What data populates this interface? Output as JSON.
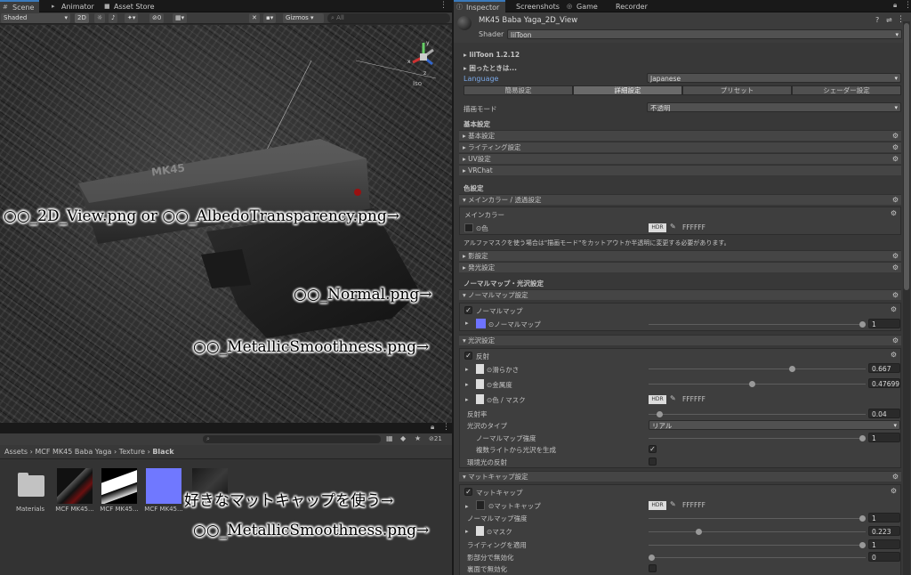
{
  "left_tabs": [
    "Scene",
    "Animator",
    "Asset Store"
  ],
  "scene_toolbar": {
    "shading": "Shaded",
    "mode_2d": "2D",
    "hidden_count": "0",
    "gizmos": "Gizmos",
    "search_placeholder": "All"
  },
  "gizmo": {
    "label": "Iso",
    "axes": [
      "y",
      "x",
      "z"
    ]
  },
  "gun_text": "MK45",
  "annotations": {
    "albedo": "○○_2D_View.png or ○○_AlbedoTransparency.png→",
    "normal": "○○_Normal.png→",
    "metallic1": "○○_MetallicSmoothness.png→",
    "matcap": "好きなマットキャップを使う→",
    "metallic2": "○○_MetallicSmoothness.png→"
  },
  "project": {
    "count": "21",
    "breadcrumb": [
      "Assets",
      "MCF MK45 Baba Yaga",
      "Texture",
      "Black"
    ],
    "assets": [
      "Materials",
      "MCF MK45...",
      "MCF MK45...",
      "MCF MK45...",
      ""
    ]
  },
  "right_tabs": [
    "Inspector",
    "Screenshots",
    "Game",
    "Recorder"
  ],
  "inspector": {
    "material_name": "MK45 Baba Yaga_2D_View",
    "shader_label": "Shader",
    "shader_value": "lilToon",
    "version": "lilToon 1.2.12",
    "help": "困ったときは...",
    "language_label": "Language",
    "language_value": "Japanese",
    "mode_tabs": [
      "簡易設定",
      "詳細設定",
      "プリセット",
      "シェーダー設定"
    ],
    "render_mode_label": "描画モード",
    "render_mode_value": "不透明",
    "basic_title": "基本設定",
    "basic_items": [
      "基本設定",
      "ライティング設定",
      "UV設定",
      "VRChat"
    ],
    "color_title": "色設定",
    "main_color_section": "メインカラー / 透過設定",
    "main_color_box": "メインカラー",
    "color_label": "色",
    "hdr": "HDR",
    "white_hex": "FFFFFF",
    "alpha_note": "アルファマスクを使う場合は\"描画モード\"をカットアウトか半透明に変更する必要があります。",
    "shadow": "影設定",
    "emission": "発光設定",
    "normal_title": "ノーマルマップ・光沢設定",
    "normal_section": "ノーマルマップ設定",
    "normal_map": "ノーマルマップ",
    "normal_value": "1",
    "gloss_section": "光沢設定",
    "reflection": "反射",
    "smoothness": "滑らかさ",
    "smoothness_value": "0.667",
    "metallic": "金属度",
    "metallic_value": "0.47699",
    "color_mask": "色 / マスク",
    "reflectance": "反射率",
    "reflectance_value": "0.04",
    "gloss_type": "光沢のタイプ",
    "gloss_type_value": "リアル",
    "normal_strength": "ノーマルマップ強度",
    "normal_strength_value": "1",
    "multi_light": "複数ライトから光沢を生成",
    "env_reflection": "環境光の反射",
    "matcap_section": "マットキャップ設定",
    "matcap": "マットキャップ",
    "matcap_item": "マットキャップ",
    "matcap_normal": "ノーマルマップ強度",
    "matcap_normal_value": "1",
    "mask": "マスク",
    "mask_value": "0.223",
    "apply_light": "ライティングを適用",
    "apply_light_value": "1",
    "shadow_disable": "影部分で無効化",
    "shadow_disable_value": "0",
    "back_disable": "裏面で無効化"
  },
  "sliders": {
    "normal": 1.0,
    "smoothness": 0.667,
    "metallic": 0.47699,
    "reflectance": 0.04,
    "normal_strength": 1.0,
    "matcap_normal": 1.0,
    "mask": 0.223,
    "apply_light": 1.0,
    "shadow_disable": 0.0
  },
  "colors": {
    "accent": "#3a79bb",
    "normal_swatch": "#6e73ff"
  }
}
